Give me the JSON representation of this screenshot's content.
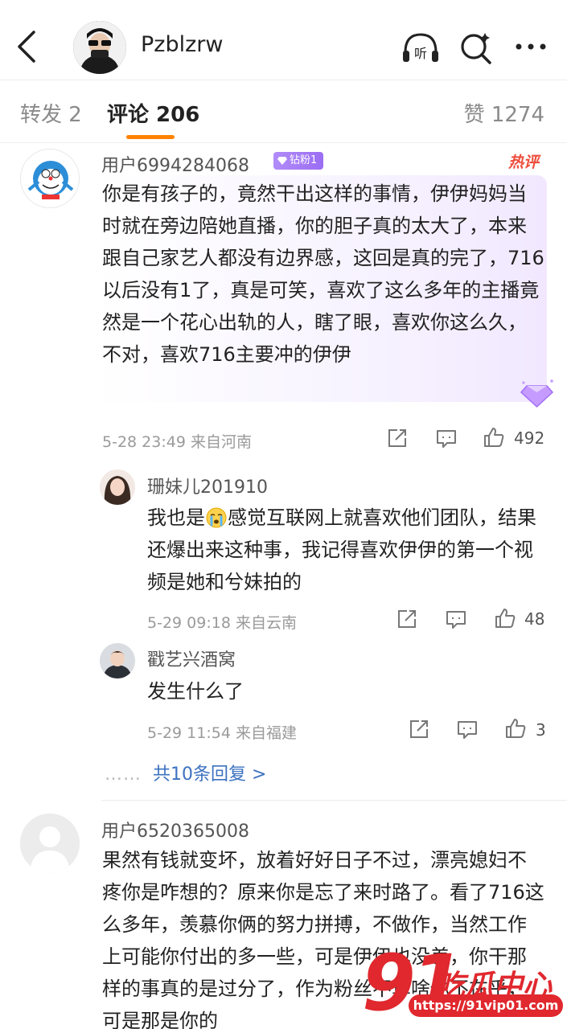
{
  "header": {
    "username": "Pzblzrw",
    "listen_label": "听"
  },
  "tabs": {
    "repost": "转发 2",
    "comments": "评论 206",
    "likes": "赞 1274"
  },
  "comments": [
    {
      "user": "用户6994284068",
      "badge": "钻粉1",
      "hot_label": "热评",
      "text": "你是有孩子的，竟然干出这样的事情，伊伊妈妈当时就在旁边陪她直播，你的胆子真的太大了，本来跟自己家艺人都没有边界感，这回是真的完了，716以后没有1了，真是可笑，喜欢了这么多年的主播竟然是一个花心出轨的人，瞎了眼，喜欢你这么久，不对，喜欢716主要冲的伊伊",
      "meta": "5-28 23:49 来自河南",
      "likes": "492",
      "replies": [
        {
          "user": "珊妹儿201910",
          "text_before": "我也是",
          "text_after": "感觉互联网上就喜欢他们团队，结果还爆出来这种事，我记得喜欢伊伊的第一个视频是她和兮妹拍的",
          "meta": "5-29 09:18 来自云南",
          "likes": "48"
        },
        {
          "user": "戳艺兴酒窝",
          "text": "发生什么了",
          "meta": "5-29 11:54 来自福建",
          "likes": "3"
        }
      ],
      "more_replies": "共10条回复 >",
      "more_dots": "……"
    },
    {
      "user": "用户6520365008",
      "text": "果然有钱就变坏，放着好好日子不过，漂亮媳妇不疼你是咋想的？原来你是忘了来时路了。看了716这么多年，羡慕你俩的努力拼搏，不做作，当然工作上可能你付出的多一些，可是伊伊也没差，你干那样的事真的是过分了，作为粉丝不算啥你不在乎，可是那是你的"
    }
  ],
  "watermark": {
    "number": "91",
    "cn": "吃瓜中心",
    "url": "https://91vip01.com"
  },
  "colors": {
    "accent": "#ff8200",
    "link": "#3c72c0",
    "hot": "#ee4d3c",
    "badge": "#9b6df3"
  },
  "icons": [
    "back-arrow-icon",
    "listen-icon",
    "search-icon",
    "more-icon",
    "share-icon",
    "comment-icon",
    "like-icon",
    "diamond-icon",
    "crying-emoji-icon"
  ]
}
